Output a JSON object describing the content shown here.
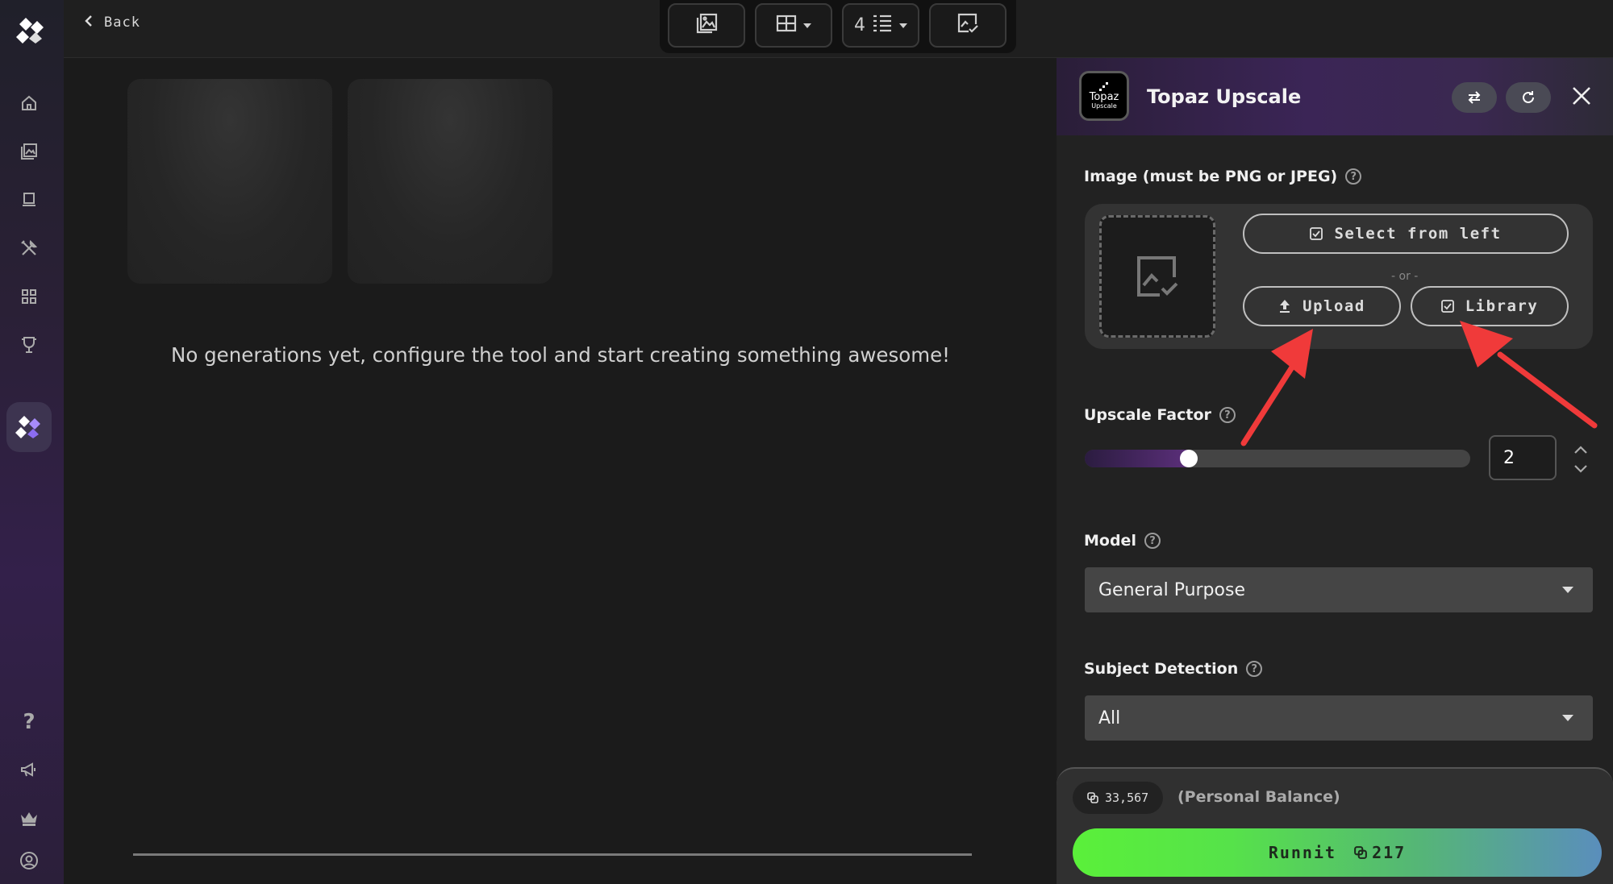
{
  "header": {
    "back_label": "Back"
  },
  "toolbar": {
    "grid_count": "4"
  },
  "main": {
    "empty_message": "No generations yet, configure the tool and start creating something awesome!"
  },
  "panel": {
    "logo_line1": "Topaz",
    "logo_line2": "Upscale",
    "title": "Topaz Upscale",
    "image_label": "Image (must be PNG or JPEG)",
    "select_from_left": "Select from left",
    "or_text": "- or -",
    "upload": "Upload",
    "library": "Library",
    "upscale_label": "Upscale Factor",
    "upscale_value": "2",
    "upscale_fraction": 0.27,
    "model_label": "Model",
    "model_value": "General Purpose",
    "subject_label": "Subject Detection",
    "subject_value": "All",
    "balance": "33,567",
    "balance_label": "(Personal Balance)",
    "run_label": "Runnit",
    "run_cost": "217"
  },
  "colors": {
    "accent_purple": "#5b2f7a",
    "run_green": "#5af03a",
    "run_blue": "#5a8ebc",
    "annotation_red": "#f03a3a"
  }
}
